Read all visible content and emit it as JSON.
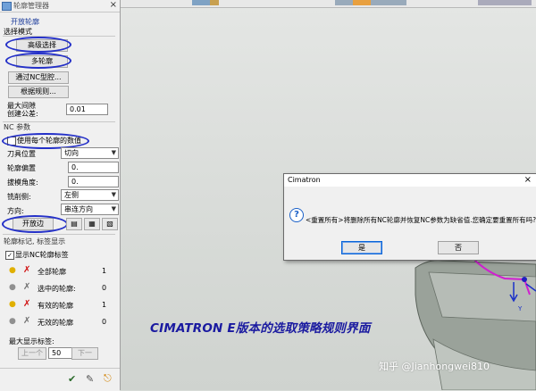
{
  "panel": {
    "title": "轮廓管理器",
    "section_open": "开放轮廓",
    "select_mode": "选择模式",
    "btn_advanced": "高级选择",
    "btn_multi": "多轮廓",
    "btn_by_nc": "通过NC型腔...",
    "btn_by_rule": "根据规则...",
    "max_gap_label_1": "最大间隙",
    "max_gap_label_2": "创建公差:",
    "max_gap_value": "0.01",
    "nc_params": "NC 参数",
    "use_each_value": "使用每个轮廓的数值",
    "tool_pos_label": "刀具位置",
    "tool_pos_value": "切向",
    "offset_label": "轮廓偏置",
    "offset_value": "0.",
    "draft_label": "拔模角度:",
    "draft_value": "0.",
    "mill_side_label": "铣削侧:",
    "mill_side_value": "左侧",
    "direction_label": "方向:",
    "direction_value": "串连方向",
    "open_edge": "开放边",
    "marker_header": "轮廓标记, 标签显示",
    "show_nc_label": "显示NC轮廓标签",
    "rows": [
      {
        "label": "全部轮廓",
        "count": "1"
      },
      {
        "label": "选中的轮廓:",
        "count": "0"
      },
      {
        "label": "有效的轮廓",
        "count": "1"
      },
      {
        "label": "无效的轮廓",
        "count": "0"
      }
    ],
    "max_show_label": "最大显示标签:",
    "prev": "上一个",
    "page_value": "50",
    "next": "下一"
  },
  "dialog": {
    "title": "Cimatron",
    "message": "<重置所有>将删除所有NC轮廓并恢复NC参数为缺省值.您确定要重置所有吗?",
    "yes": "是",
    "no": "否"
  },
  "caption": "CIMATRON E版本的选取策略规则界面",
  "watermark": "知乎 @Jianhongwei810",
  "colors": {
    "highlight": "#2430c8",
    "caption": "#1a1aa0",
    "model_magenta": "#d020d0"
  }
}
